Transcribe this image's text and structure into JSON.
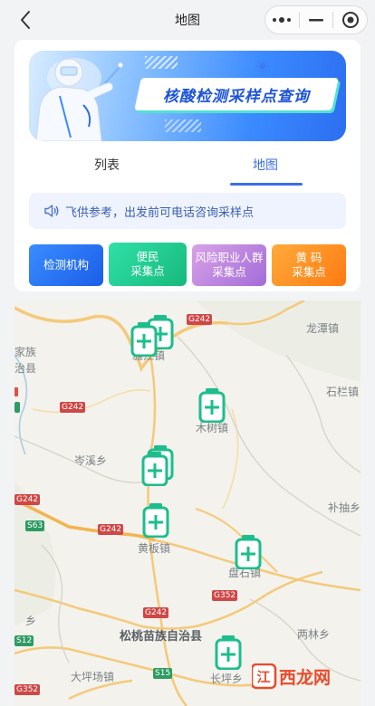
{
  "navbar": {
    "title": "地图",
    "icons": [
      "back-chevron-icon",
      "more-dots-icon",
      "minimize-icon",
      "close-target-icon"
    ]
  },
  "banner": {
    "title": "核酸检测采样点查询"
  },
  "tabs": [
    {
      "label": "列表",
      "active": false
    },
    {
      "label": "地图",
      "active": true
    }
  ],
  "notice": {
    "text": "飞供参考，出发前可电话咨询采样点",
    "icon": "speaker-icon"
  },
  "categories": [
    {
      "line1": "检测机构",
      "line2": "",
      "color": "#2f7cf6"
    },
    {
      "line1": "便民",
      "line2": "采集点",
      "color": "#22cc92"
    },
    {
      "line1": "风险职业人群",
      "line2": "采集点",
      "color": "#b985e0"
    },
    {
      "line1": "黄 码",
      "line2": "采集点",
      "color": "#ff9325"
    }
  ],
  "map": {
    "places": [
      {
        "label": "家族"
      },
      {
        "label": "治县"
      },
      {
        "label": "雅江镇"
      },
      {
        "label": "龙潭镇"
      },
      {
        "label": "石栏镇"
      },
      {
        "label": "木树镇"
      },
      {
        "label": "岑溪乡"
      },
      {
        "label": "补抽乡"
      },
      {
        "label": "黄板镇"
      },
      {
        "label": "盘石镇"
      },
      {
        "label": "乡"
      },
      {
        "label": "松桃苗族自治县"
      },
      {
        "label": "两林乡"
      },
      {
        "label": "大坪场镇"
      },
      {
        "label": "长坪乡"
      }
    ],
    "roads": [
      {
        "label": "G242"
      },
      {
        "label": "G242"
      },
      {
        "label": "G242"
      },
      {
        "label": "G242"
      },
      {
        "label": "G242"
      },
      {
        "label": "G352"
      },
      {
        "label": "G352"
      },
      {
        "label": "S63"
      },
      {
        "label": "S15"
      },
      {
        "label": "S12"
      }
    ],
    "marker_color": "#1dbd8c"
  },
  "watermark": {
    "text": "江西龙网"
  }
}
